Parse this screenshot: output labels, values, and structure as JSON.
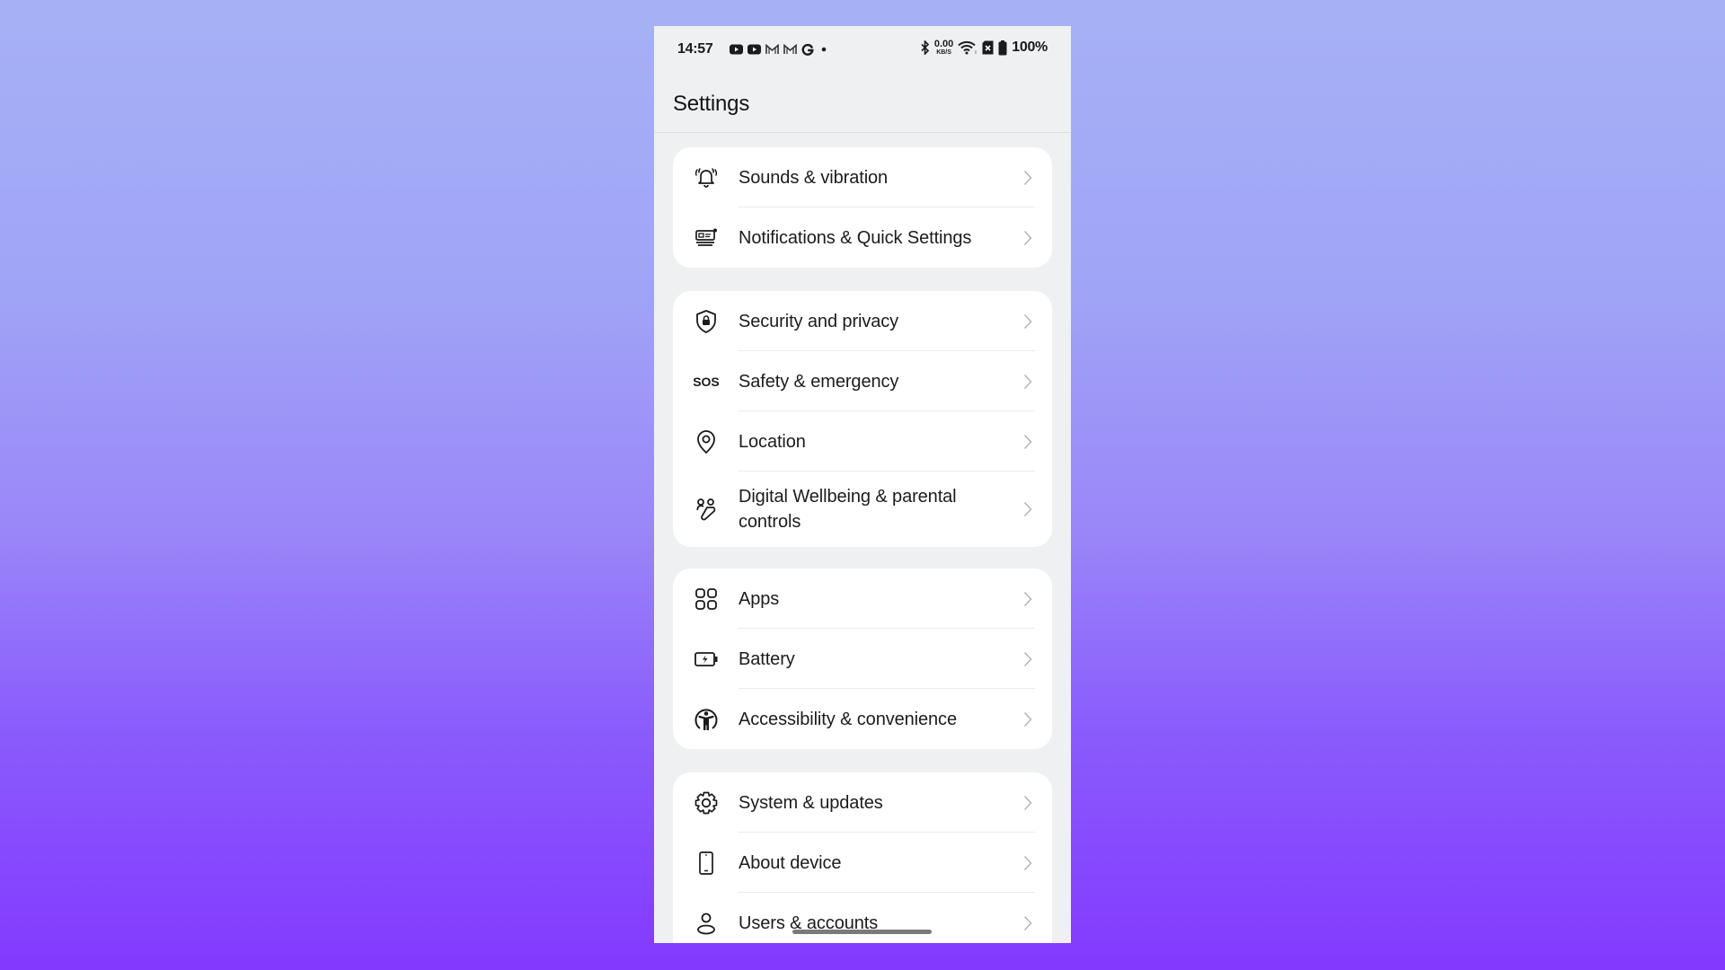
{
  "status_bar": {
    "time": "14:57",
    "notification_icons": [
      "youtube-icon",
      "youtube-icon",
      "gmail-icon",
      "gmail-icon",
      "google-icon",
      "more-dot-icon"
    ],
    "system_icons": [
      "bluetooth-icon",
      "network-speed",
      "wifi-icon",
      "sim-none-icon",
      "battery-icon"
    ],
    "network_speed_value": "0.00",
    "network_speed_unit": "KB/S",
    "battery_percent": "100%"
  },
  "header": {
    "title": "Settings"
  },
  "groups": [
    {
      "items": [
        {
          "label": "Sounds & vibration",
          "icon": "bell-ringing-icon"
        },
        {
          "label": "Notifications & Quick Settings",
          "icon": "notifications-panel-icon"
        }
      ]
    },
    {
      "items": [
        {
          "label": "Security and privacy",
          "icon": "shield-lock-icon"
        },
        {
          "label": "Safety & emergency",
          "icon": "sos-icon",
          "icon_text": "SOS"
        },
        {
          "label": "Location",
          "icon": "location-pin-icon"
        },
        {
          "label": "Digital Wellbeing & parental controls",
          "icon": "wellbeing-icon"
        }
      ]
    },
    {
      "items": [
        {
          "label": "Apps",
          "icon": "apps-grid-icon"
        },
        {
          "label": "Battery",
          "icon": "battery-charging-icon"
        },
        {
          "label": "Accessibility & convenience",
          "icon": "accessibility-icon"
        }
      ]
    },
    {
      "items": [
        {
          "label": "System & updates",
          "icon": "gear-icon"
        },
        {
          "label": "About device",
          "icon": "phone-icon"
        },
        {
          "label": "Users & accounts",
          "icon": "user-icon"
        }
      ]
    }
  ],
  "colors": {
    "phone_background": "#EFF0F2",
    "card_background": "#FFFFFF",
    "text": "#1C1C1C",
    "chevron": "#B5B5B5",
    "page_gradient_top": "#A6B1F5",
    "page_gradient_bottom": "#8339FE"
  }
}
